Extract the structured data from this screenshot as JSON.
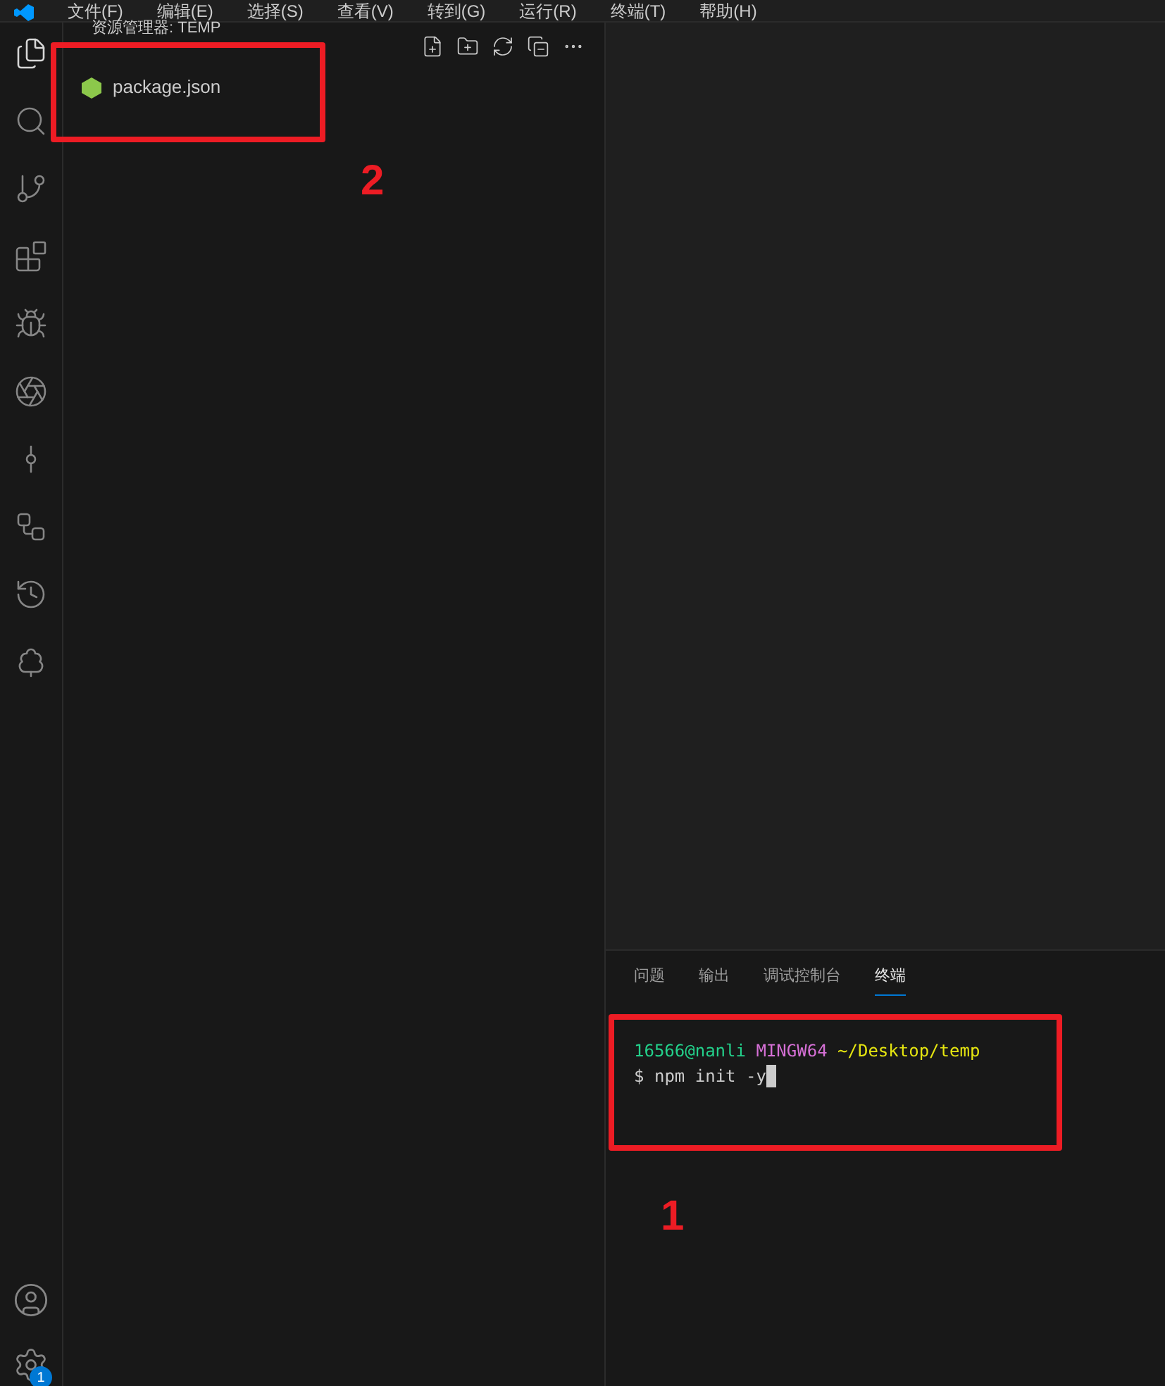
{
  "menu_bar": {
    "items": [
      "文件(F)",
      "编辑(E)",
      "选择(S)",
      "查看(V)",
      "转到(G)",
      "运行(R)",
      "终端(T)",
      "帮助(H)"
    ]
  },
  "activity_bar": {
    "items": [
      {
        "kind": "files",
        "selected": true
      },
      {
        "kind": "search",
        "selected": false
      },
      {
        "kind": "source-control",
        "selected": false
      },
      {
        "kind": "extensions",
        "selected": false
      },
      {
        "kind": "run-debug",
        "selected": false
      },
      {
        "kind": "ai",
        "selected": false
      },
      {
        "kind": "git-graph",
        "selected": false
      },
      {
        "kind": "workflow",
        "selected": false
      },
      {
        "kind": "history",
        "selected": false
      },
      {
        "kind": "tree",
        "selected": false
      }
    ],
    "account": {
      "kind": "account"
    },
    "settings": {
      "badge": "1"
    }
  },
  "explorer": {
    "title": "资源管理器: TEMP",
    "files": [
      {
        "name": "package.json",
        "color": "#8cc84b"
      }
    ]
  },
  "panel": {
    "tabs": [
      {
        "label": "问题",
        "selected": false
      },
      {
        "label": "输出",
        "selected": false
      },
      {
        "label": "调试控制台",
        "selected": false
      },
      {
        "label": "终端",
        "selected": true
      }
    ],
    "terminal": {
      "user": "16566@nanli",
      "system": "MINGW64",
      "path": "~/Desktop/temp",
      "prompt": "$",
      "command": "npm init -y"
    }
  },
  "annotations": [
    {
      "label": "2"
    },
    {
      "label": "1"
    }
  ]
}
